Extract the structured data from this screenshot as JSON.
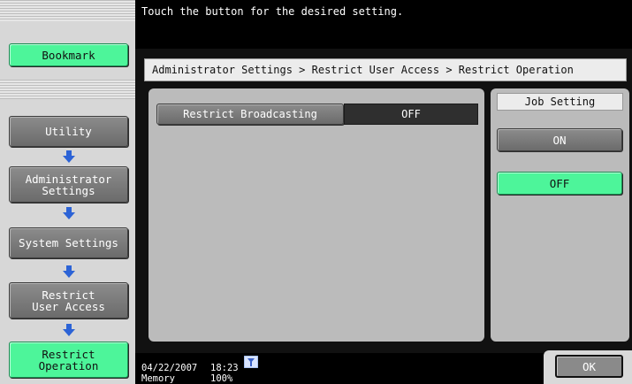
{
  "message": "Touch the button for the desired setting.",
  "sidebar": {
    "bookmark": "Bookmark",
    "items": [
      {
        "label": "Utility"
      },
      {
        "label": "Administrator\nSettings"
      },
      {
        "label": "System Settings"
      },
      {
        "label": "Restrict\nUser Access"
      },
      {
        "label": "Restrict\nOperation"
      }
    ]
  },
  "breadcrumb": "Administrator Settings > Restrict User Access > Restrict Operation",
  "setting": {
    "label": "Restrict Broadcasting",
    "value": "OFF"
  },
  "job_setting": {
    "label": "Job Setting",
    "on_label": "ON",
    "off_label": "OFF",
    "selected": "OFF"
  },
  "status": {
    "date": "04/22/2007",
    "time": "18:23",
    "memory_label": "Memory",
    "memory_value": "100%"
  },
  "ok_label": "OK",
  "colors": {
    "accent_green": "#4df59a",
    "button_gray": "#7a7a7a"
  }
}
